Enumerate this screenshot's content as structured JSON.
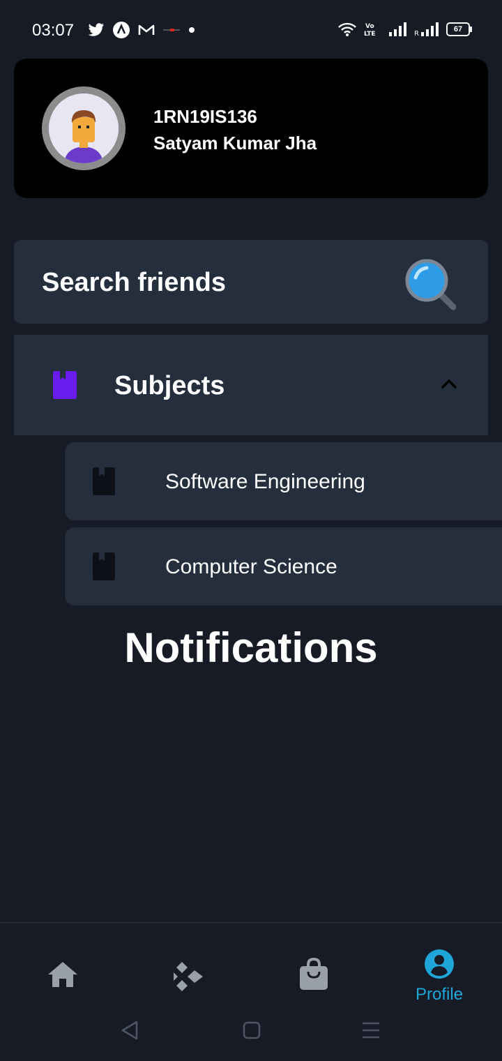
{
  "status_bar": {
    "time": "03:07",
    "battery": "67",
    "left_icons": [
      "twitter-icon",
      "app-icon",
      "gmail-icon",
      "news-icon",
      "dot-icon"
    ],
    "right_icons": [
      "wifi-icon",
      "volte-icon",
      "signal-icon",
      "signal-roaming-icon",
      "battery-icon"
    ]
  },
  "profile": {
    "id": "1RN19IS136",
    "name": "Satyam Kumar Jha"
  },
  "search": {
    "label": "Search friends"
  },
  "subjects": {
    "label": "Subjects",
    "accent": "#6a1cf0",
    "items": [
      {
        "label": "Software Engineering"
      },
      {
        "label": "Computer Science"
      }
    ]
  },
  "notifications": {
    "title": "Notifications"
  },
  "bottom_nav": {
    "items": [
      {
        "icon": "home-icon",
        "label": ""
      },
      {
        "icon": "diamond-icon",
        "label": ""
      },
      {
        "icon": "shopping-bag-icon",
        "label": ""
      },
      {
        "icon": "profile-icon",
        "label": "Profile"
      }
    ],
    "active_color": "#1fa6d8",
    "inactive_color": "#9aa0a8"
  },
  "system_nav": [
    "back-icon",
    "home-square-icon",
    "menu-icon"
  ]
}
